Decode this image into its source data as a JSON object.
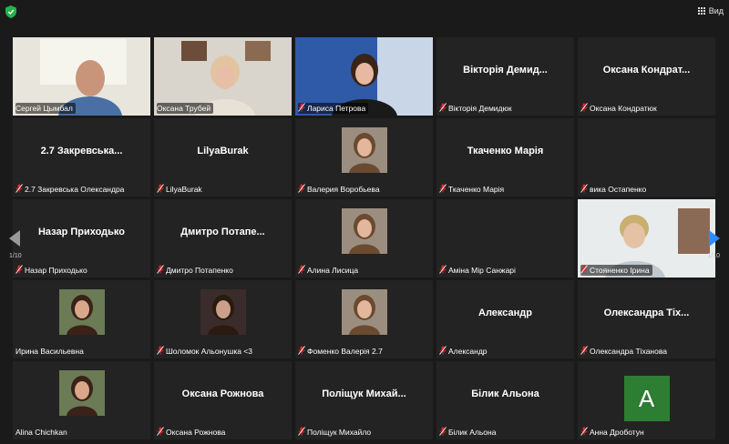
{
  "toolbar": {
    "view_label": "Вид"
  },
  "pagination": {
    "left_label": "1/10",
    "right_label": "1/10"
  },
  "colors": {
    "active_border": "#c6e000",
    "tile_bg": "#232323",
    "mic_muted": "#e02828",
    "avatar_green": "#2d7d32",
    "arrow_blue": "#2d8cff"
  },
  "tiles": [
    {
      "label": "Сергей Цымбал",
      "display": "",
      "mode": "video",
      "muted": false
    },
    {
      "label": "Оксана Трубей",
      "display": "",
      "mode": "video",
      "muted": false
    },
    {
      "label": "Лариса Петрова",
      "display": "",
      "mode": "video",
      "muted": true
    },
    {
      "label": "Вікторія Демидюк",
      "display": "Вікторія Демид...",
      "mode": "name",
      "muted": true
    },
    {
      "label": "Оксана Кондратюк",
      "display": "Оксана  Кондрат...",
      "mode": "name",
      "muted": true
    },
    {
      "label": "2.7 Закревська Олександра",
      "display": "2.7  Закревська...",
      "mode": "name",
      "muted": true
    },
    {
      "label": "LilyaBurak",
      "display": "LilyaBurak",
      "mode": "name",
      "muted": true
    },
    {
      "label": "Валерия Воробьева",
      "display": "",
      "mode": "photo",
      "muted": true
    },
    {
      "label": "Ткаченко Марія",
      "display": "Ткаченко Марія",
      "mode": "name",
      "muted": true
    },
    {
      "label": "вика Остапенко",
      "display": "",
      "mode": "blank",
      "muted": true
    },
    {
      "label": "Назар Приходько",
      "display": "Назар Приходько",
      "mode": "name",
      "muted": true
    },
    {
      "label": "Дмитро Потапенко",
      "display": "Дмитро  Потапе...",
      "mode": "name",
      "muted": true
    },
    {
      "label": "Алина Лисица",
      "display": "",
      "mode": "photo",
      "muted": true
    },
    {
      "label": "Аміна Мір Санжарі",
      "display": "",
      "mode": "blank",
      "muted": true
    },
    {
      "label": "Стояненко Ірина",
      "display": "",
      "mode": "video",
      "muted": true
    },
    {
      "label": "Ирина Васильевна",
      "display": "",
      "mode": "photo",
      "muted": false
    },
    {
      "label": "Шоломок Альонушка <3",
      "display": "",
      "mode": "photo",
      "muted": true
    },
    {
      "label": "Фоменко Валерія 2.7",
      "display": "",
      "mode": "photo",
      "muted": true
    },
    {
      "label": "Александр",
      "display": "Александр",
      "mode": "name",
      "muted": true
    },
    {
      "label": "Олександра Тіханова",
      "display": "Олександра  Тіх...",
      "mode": "name",
      "muted": true
    },
    {
      "label": "Alina Chichkan",
      "display": "",
      "mode": "photo",
      "muted": false
    },
    {
      "label": "Оксана Рожнова",
      "display": "Оксана Рожнова",
      "mode": "name",
      "muted": true
    },
    {
      "label": "Поліщук Михайло",
      "display": "Поліщук  Михай...",
      "mode": "name",
      "muted": true
    },
    {
      "label": "Білик Альона",
      "display": "Білик Альона",
      "mode": "name",
      "muted": true
    },
    {
      "label": "Анна Дроботун",
      "display": "",
      "mode": "avatar",
      "avatar_letter": "A",
      "muted": true
    }
  ]
}
